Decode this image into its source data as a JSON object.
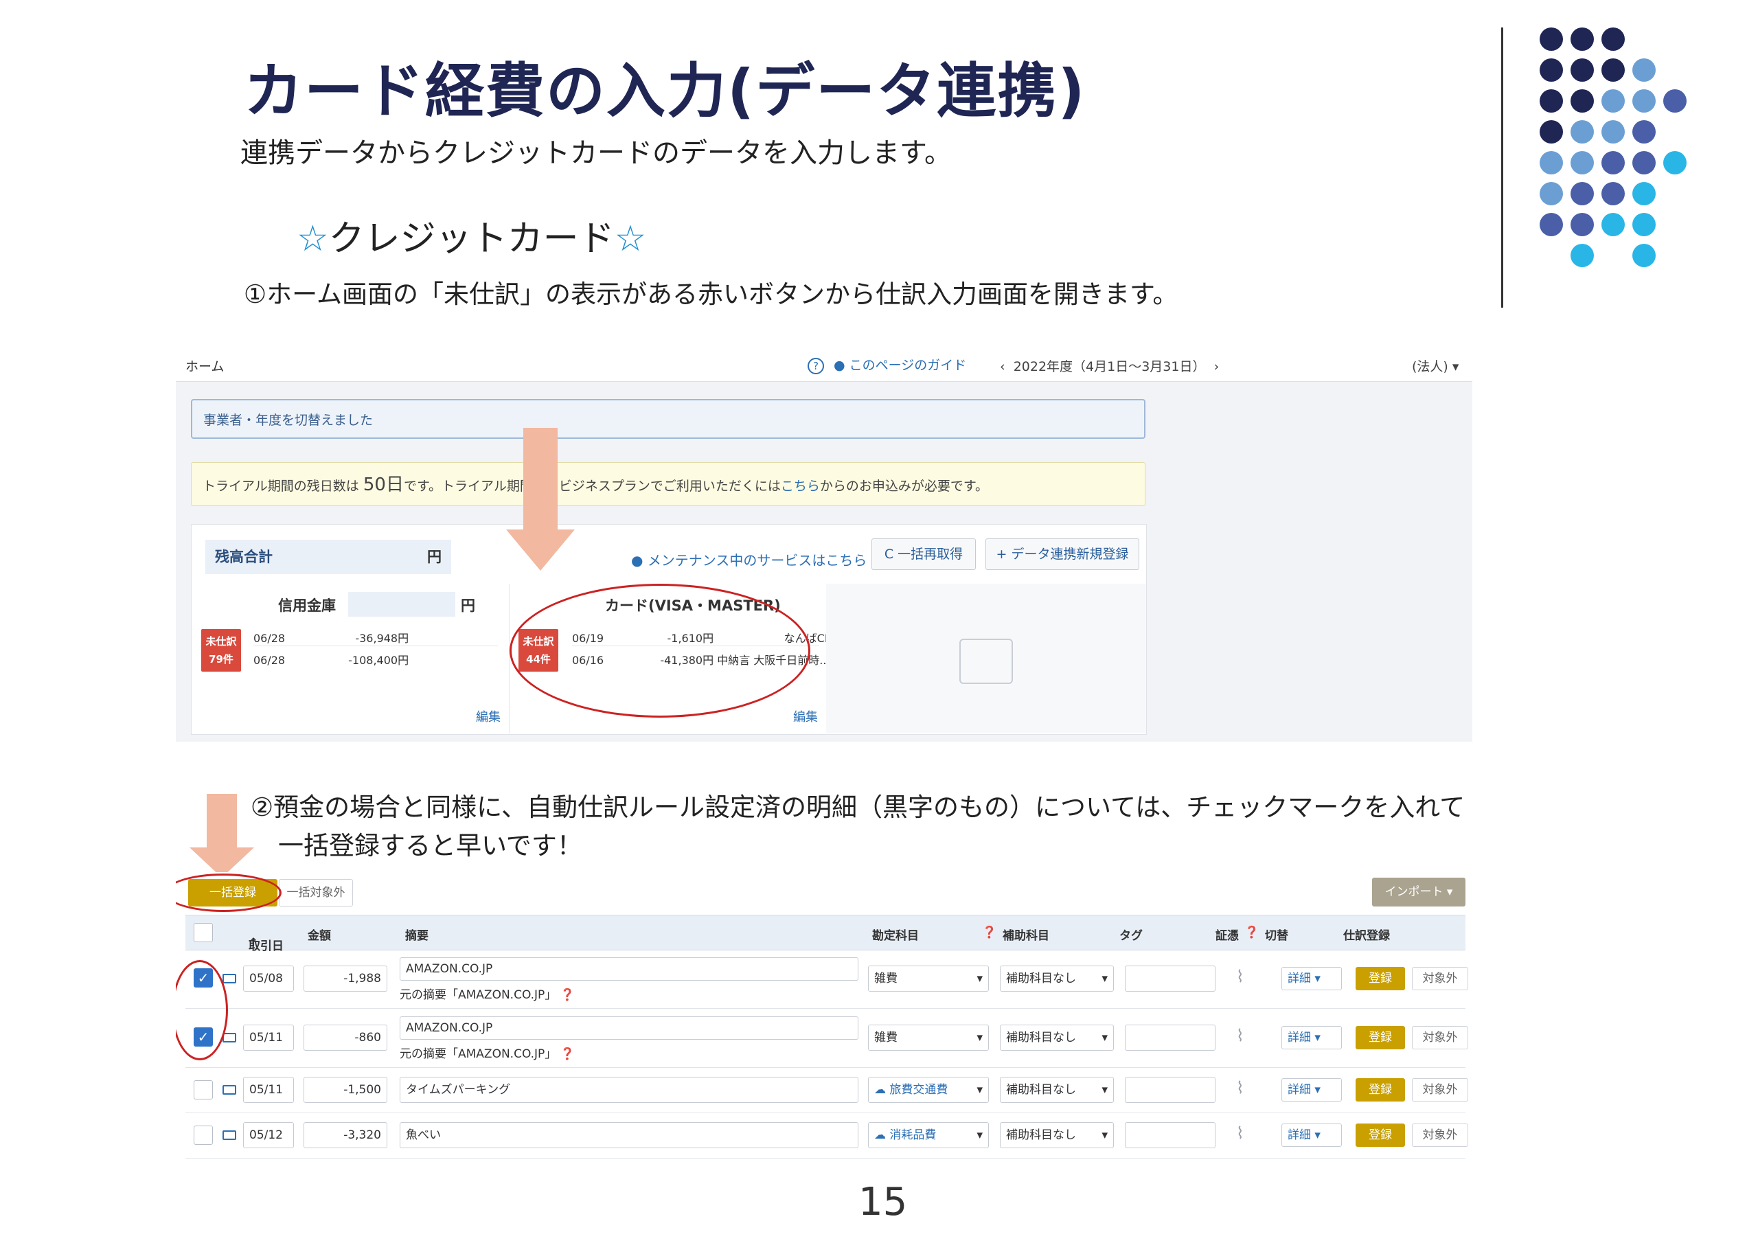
{
  "slide": {
    "title": "カード経費の入力(データ連携)",
    "subtitle": "連携データからクレジットカードのデータを入力します。",
    "section": "クレジットカード",
    "star": "☆",
    "step1": "①ホーム画面の「未仕訳」の表示がある赤いボタンから仕訳入力画面を開きます。",
    "step2_line1": "②預金の場合と同様に、自動仕訳ルール設定済の明細（黒字のもの）については、チェックマークを入れて",
    "step2_line2": "一括登録すると早いです！",
    "page_number": "15"
  },
  "colors": {
    "navy": "#1f2654",
    "mid_blue": "#4a5fa8",
    "light_blue": "#6b9fd4",
    "cyan": "#29b6e6",
    "arrow": "#f2b8a0",
    "circle": "#cc2222"
  },
  "home": {
    "breadcrumb": "ホーム",
    "guide": "このページのガイド",
    "fiscal_year": "2022年度（4月1日〜3月31日）",
    "corp": "(法人)",
    "info_message": "事業者・年度を切替えました",
    "trial_prefix": "トライアル期間の残日数は",
    "trial_days": "50日",
    "trial_mid": "です。トライアル期間",
    "trial_suffix": "後もビジネスプランでご利用いただくには",
    "trial_link": "こちら",
    "trial_end": "からのお申込みが必要です。",
    "balance_label": "残高合計",
    "balance_unit": "円",
    "maintenance_link": "メンテナンス中のサービスはこちら",
    "refresh_button": "一括再取得",
    "new_link_button": "データ連携新規登録",
    "bank": {
      "name": "信用金庫",
      "unit": "円",
      "badge_label": "未仕訳",
      "badge_count": "79件",
      "rows": [
        {
          "date": "06/28",
          "amount": "-36,948円"
        },
        {
          "date": "06/28",
          "amount": "-108,400円"
        }
      ],
      "edit": "編集"
    },
    "credit_card": {
      "name": "カード(VISA・MASTER)",
      "badge_label": "未仕訳",
      "badge_count": "44件",
      "rows": [
        {
          "date": "06/19",
          "amount": "-1,610円",
          "desc": "なんばCITY"
        },
        {
          "date": "06/16",
          "amount": "-41,380円",
          "desc": "中納言 大阪千日前時..."
        }
      ],
      "edit": "編集"
    }
  },
  "journal": {
    "bulk_register": "一括登録",
    "bulk_exclude": "一括対象外",
    "import": "インポート",
    "columns": {
      "date": "取引日",
      "amount": "金額",
      "summary": "摘要",
      "account": "勘定科目",
      "sub_account": "補助科目",
      "tag": "タグ",
      "evidence": "証憑",
      "switch": "切替",
      "register": "仕訳登録"
    },
    "detail_label": "詳細",
    "register_label": "登録",
    "exclude_label": "対象外",
    "rows": [
      {
        "checked": true,
        "date": "05/08",
        "amount": "-1,988",
        "summary": "AMAZON.CO.JP",
        "original": "元の摘要「AMAZON.CO.JP」",
        "account": "雑費",
        "sub_account": "補助科目なし"
      },
      {
        "checked": true,
        "date": "05/11",
        "amount": "-860",
        "summary": "AMAZON.CO.JP",
        "original": "元の摘要「AMAZON.CO.JP」",
        "account": "雑費",
        "sub_account": "補助科目なし"
      },
      {
        "checked": false,
        "date": "05/11",
        "amount": "-1,500",
        "summary": "タイムズパーキング",
        "original": "",
        "account": "旅費交通費",
        "sub_account": "補助科目なし"
      },
      {
        "checked": false,
        "date": "05/12",
        "amount": "-3,320",
        "summary": "魚べい",
        "original": "",
        "account": "消耗品費",
        "sub_account": "補助科目なし"
      }
    ]
  }
}
